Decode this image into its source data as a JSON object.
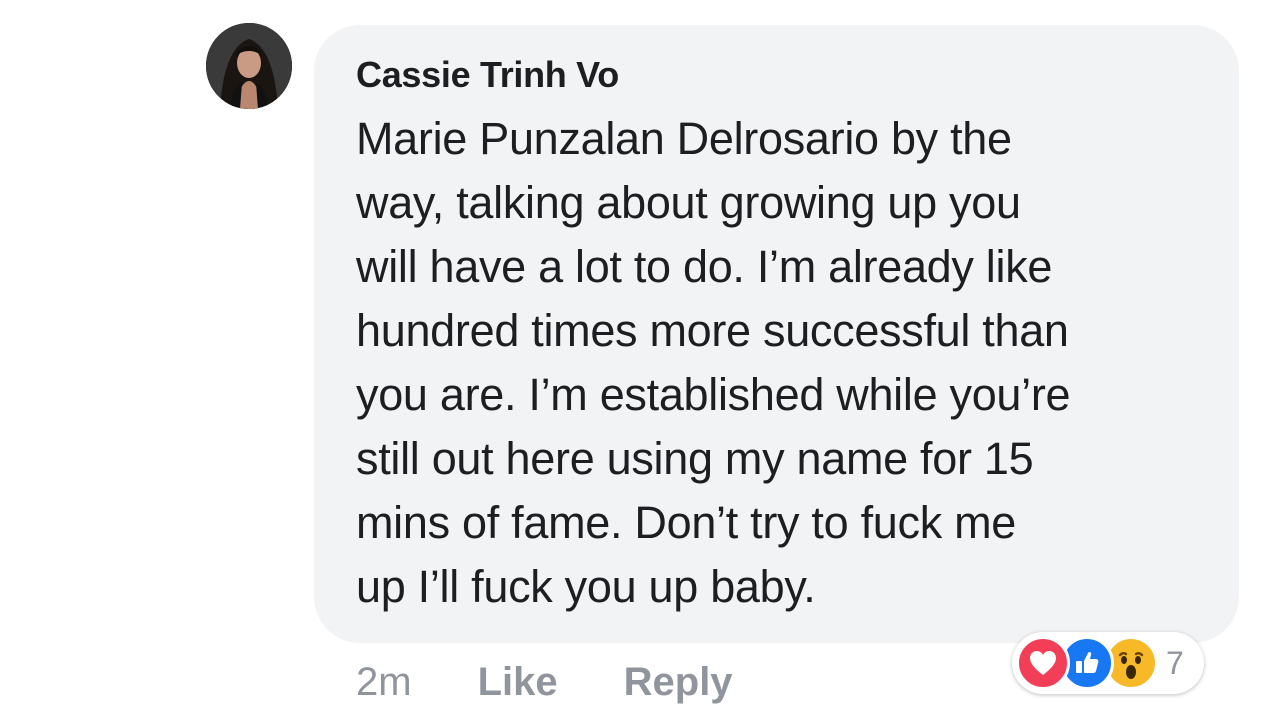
{
  "comment": {
    "author": "Cassie Trinh Vo",
    "mention": "Marie Punzalan Delrosario",
    "lines": [
      " by the",
      "way,  talking about growing up you",
      "will have a lot to do. I’m already like",
      "hundred times more successful than",
      "you are. I’m established while you’re",
      "still out here using my name for 15",
      "mins of fame. Don’t try to fuck me",
      "up I’ll fuck you up baby."
    ]
  },
  "actions": {
    "time": "2m",
    "like_label": "Like",
    "reply_label": "Reply"
  },
  "reactions": {
    "icons": [
      "love-icon",
      "like-icon",
      "wow-icon"
    ],
    "count": "7",
    "colors": {
      "love": "#f33e58",
      "like": "#1877f2",
      "wow": "#f7b928"
    }
  },
  "colors": {
    "bubble": "#f2f3f5",
    "text": "#1c1e21",
    "meta": "#90949c"
  }
}
